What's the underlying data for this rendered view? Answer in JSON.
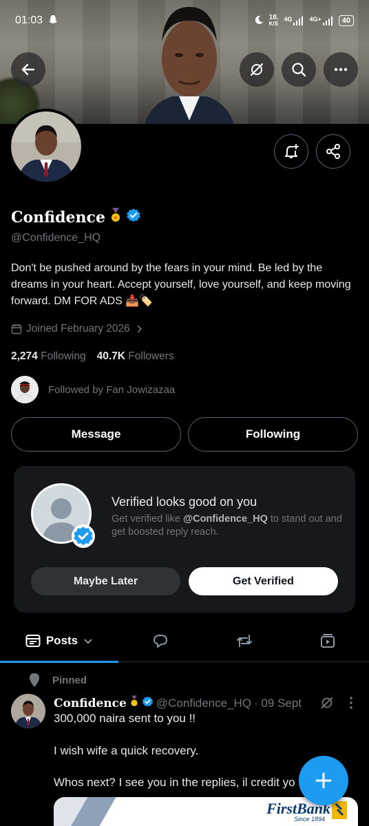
{
  "status_bar": {
    "time": "01:03",
    "net_speed_value": "18.",
    "net_speed_unit": "K/S",
    "signal_1": "4G",
    "signal_2": "4G+",
    "battery": "40"
  },
  "profile": {
    "name": "Confidence",
    "handle": "@Confidence_HQ",
    "bio": "Don't be pushed around by the fears in your mind. Be led by the dreams in your heart. Accept yourself, love yourself, and keep moving forward. DM FOR ADS 📥🏷️",
    "joined": "Joined February 2026",
    "following_count": "2,274",
    "following_label": "Following",
    "followers_count": "40.7K",
    "followers_label": "Followers",
    "followed_by": "Followed by Fan Jowizazaa"
  },
  "actions": {
    "message": "Message",
    "following": "Following"
  },
  "verify_card": {
    "title": "Verified looks good on you",
    "desc_prefix": "Get verified like ",
    "desc_handle": "@Confidence_HQ",
    "desc_suffix": " to stand out and get boosted reply reach.",
    "maybe_later": "Maybe Later",
    "get_verified": "Get Verified"
  },
  "tabs": {
    "posts": "Posts"
  },
  "post": {
    "pinned": "Pinned",
    "author": "Confidence",
    "handle": "@Confidence_HQ",
    "date": "· 09 Sept",
    "line1": "300,000 naira sent to you !!",
    "line2": "I wish wife a quick recovery.",
    "line3": "Whos next? I see you in the replies, il credit yo",
    "media_brand": "FirstBank",
    "media_since": "Since 1894"
  },
  "colors": {
    "accent": "#1d9bf0",
    "background": "#000000",
    "muted": "#71767b"
  }
}
